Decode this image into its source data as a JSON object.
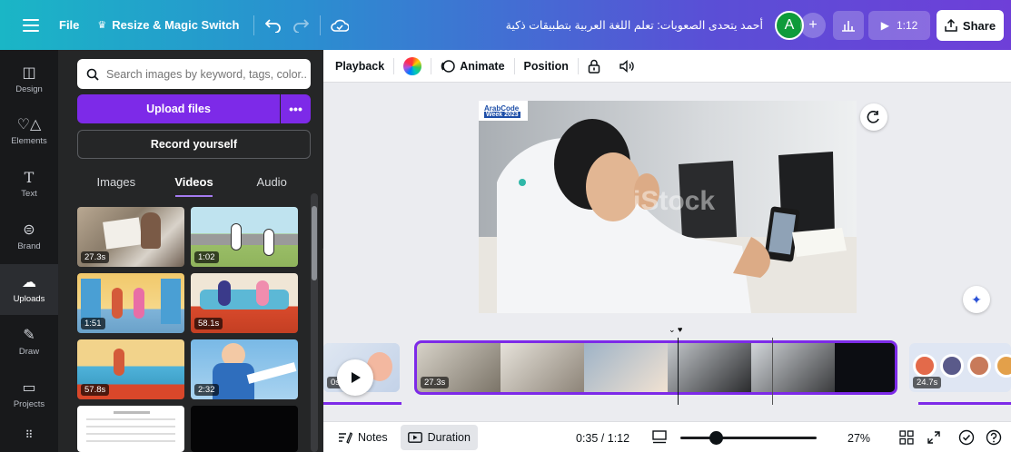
{
  "topbar": {
    "file_label": "File",
    "resize_label": "Resize & Magic Switch",
    "crown_icon": "crown-icon",
    "undo_icon": "undo-icon",
    "redo_icon": "redo-icon",
    "cloud_icon": "cloud-saved-icon",
    "title": "أحمد يتحدى الصعوبات: تعلم اللغة العربية بتطبيقات ذكية",
    "avatar_initial": "A",
    "add_label": "+",
    "present_time": "1:12",
    "share_label": "Share"
  },
  "rail": {
    "items": [
      {
        "label": "Design",
        "icon": "design-icon"
      },
      {
        "label": "Elements",
        "icon": "elements-icon"
      },
      {
        "label": "Text",
        "icon": "text-icon"
      },
      {
        "label": "Brand",
        "icon": "brand-icon"
      },
      {
        "label": "Uploads",
        "icon": "uploads-icon"
      },
      {
        "label": "Draw",
        "icon": "draw-icon"
      },
      {
        "label": "Projects",
        "icon": "projects-icon"
      }
    ]
  },
  "panel": {
    "search_placeholder": "Search images by keyword, tags, color...",
    "upload_label": "Upload files",
    "upload_more": "•••",
    "record_label": "Record yourself",
    "tabs": [
      "Images",
      "Videos",
      "Audio"
    ],
    "active_tab": "Videos",
    "thumbs": [
      {
        "duration": "27.3s"
      },
      {
        "duration": "1:02"
      },
      {
        "duration": "1:51"
      },
      {
        "duration": "58.1s"
      },
      {
        "duration": "57.8s"
      },
      {
        "duration": "2:32"
      }
    ]
  },
  "ctxbar": {
    "playback": "Playback",
    "animate": "Animate",
    "position": "Position"
  },
  "canvas": {
    "watermark_line1": "ArabCode",
    "watermark_line2": "Week 2023"
  },
  "timeline": {
    "prev_duration": "0s",
    "main_duration": "27.3s",
    "next_duration": "24.7s"
  },
  "bottombar": {
    "notes": "Notes",
    "duration": "Duration",
    "time": "0:35 / 1:12",
    "zoom": "27%",
    "zoom_fraction": 0.27
  },
  "colors": {
    "accent": "#7d2ae8",
    "topbar_start": "#1ab6c6",
    "topbar_end": "#6e3fd8",
    "rail_bg": "#18191b",
    "panel_bg": "#252627"
  }
}
